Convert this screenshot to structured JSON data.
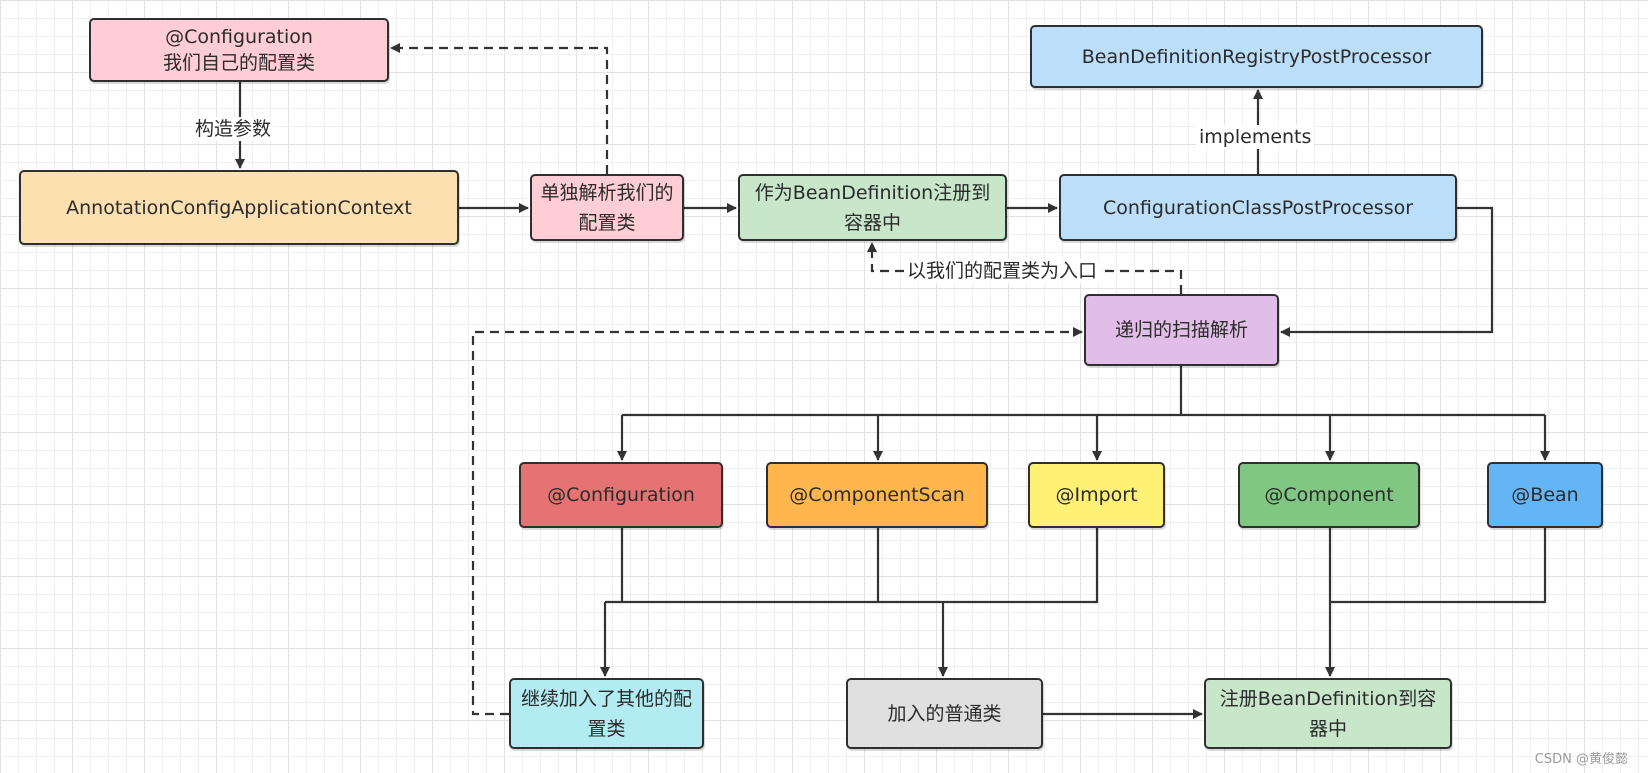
{
  "nodes": {
    "config_class": {
      "line1": "@Configuration",
      "line2": "我们自己的配置类",
      "color": "#ffcdd5"
    },
    "context": {
      "label": "AnnotationConfigApplicationContext",
      "color": "#fde0b0"
    },
    "parse_config": {
      "label": "单独解析我们的配置类",
      "color": "#ffcdd5"
    },
    "register_bd": {
      "label": "作为BeanDefinition注册到容器中",
      "color": "#c8e6c9"
    },
    "ccpp": {
      "label": "ConfigurationClassPostProcessor",
      "color": "#bbdefb"
    },
    "bdrpp": {
      "label": "BeanDefinitionRegistryPostProcessor",
      "color": "#bbdefb"
    },
    "recursive_scan": {
      "label": "递归的扫描解析",
      "color": "#e1bee7"
    },
    "ann_configuration": {
      "label": "@Configuration",
      "color": "#e57373"
    },
    "ann_componentscan": {
      "label": "@ComponentScan",
      "color": "#ffb74d"
    },
    "ann_import": {
      "label": "@Import",
      "color": "#fff176"
    },
    "ann_component": {
      "label": "@Component",
      "color": "#81c784"
    },
    "ann_bean": {
      "label": "@Bean",
      "color": "#64b5f6"
    },
    "more_configs": {
      "label": "继续加入了其他的配置类",
      "color": "#b2ebf2"
    },
    "normal_classes": {
      "label": "加入的普通类",
      "color": "#e0e0e0"
    },
    "register_bd_final": {
      "label": "注册BeanDefinition到容器中",
      "color": "#c8e6c9"
    }
  },
  "edge_labels": {
    "ctor_arg": "构造参数",
    "implements": "implements",
    "entry": "以我们的配置类为入口"
  },
  "watermark": "CSDN @黄俊懿"
}
